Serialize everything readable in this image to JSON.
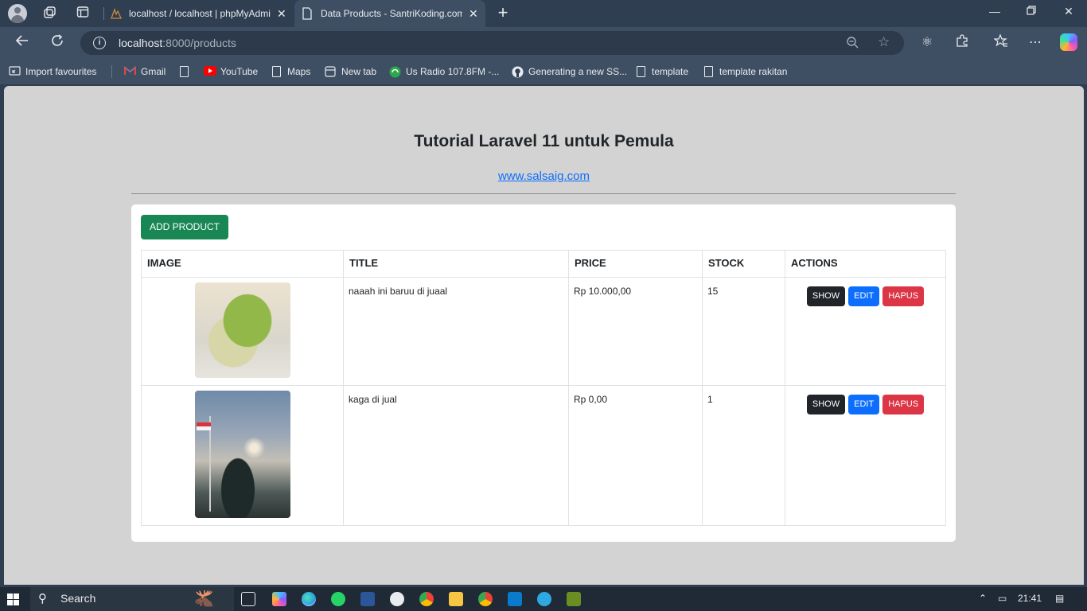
{
  "browser": {
    "tabs": [
      {
        "title": "localhost / localhost | phpMyAdmin",
        "active": false
      },
      {
        "title": "Data Products - SantriKoding.com",
        "active": true
      }
    ],
    "address": {
      "host": "localhost",
      "rest": ":8000/products"
    },
    "bookmarks": [
      {
        "label": "Import favourites",
        "icon": "import-icon"
      },
      {
        "label": "Gmail",
        "icon": "gmail-icon"
      },
      {
        "label": "",
        "icon": "page-icon"
      },
      {
        "label": "YouTube",
        "icon": "youtube-icon"
      },
      {
        "label": "Maps",
        "icon": "page-icon"
      },
      {
        "label": "New tab",
        "icon": "newtab-icon"
      },
      {
        "label": "Us Radio 107.8FM -...",
        "icon": "radio-icon"
      },
      {
        "label": "Generating a new SS...",
        "icon": "github-icon"
      },
      {
        "label": "template",
        "icon": "page-icon"
      },
      {
        "label": "template rakitan",
        "icon": "page-icon"
      }
    ],
    "colors": {
      "chrome": "#2f3e51",
      "toolbar": "#3f4f63"
    }
  },
  "page": {
    "title": "Tutorial Laravel 11 untuk Pemula",
    "link": "www.salsaig.com",
    "add_button": "ADD PRODUCT",
    "table": {
      "headers": [
        "IMAGE",
        "TITLE",
        "PRICE",
        "STOCK",
        "ACTIONS"
      ],
      "rows": [
        {
          "image": "matcha-cheesecake-photo",
          "title": "naaah ini baruu di juaal",
          "price": "Rp 10.000,00",
          "stock": "15"
        },
        {
          "image": "sky-flag-photo",
          "title": "kaga di jual",
          "price": "Rp 0,00",
          "stock": "1"
        }
      ],
      "actions": {
        "show": "SHOW",
        "edit": "EDIT",
        "delete": "HAPUS"
      }
    },
    "colors": {
      "background": "#d3d3d3",
      "add": "#198754",
      "show": "#212529",
      "edit": "#0d6efd",
      "delete": "#dc3545",
      "link": "#0d6efd"
    }
  },
  "taskbar": {
    "search_label": "Search",
    "time": "21:41"
  }
}
